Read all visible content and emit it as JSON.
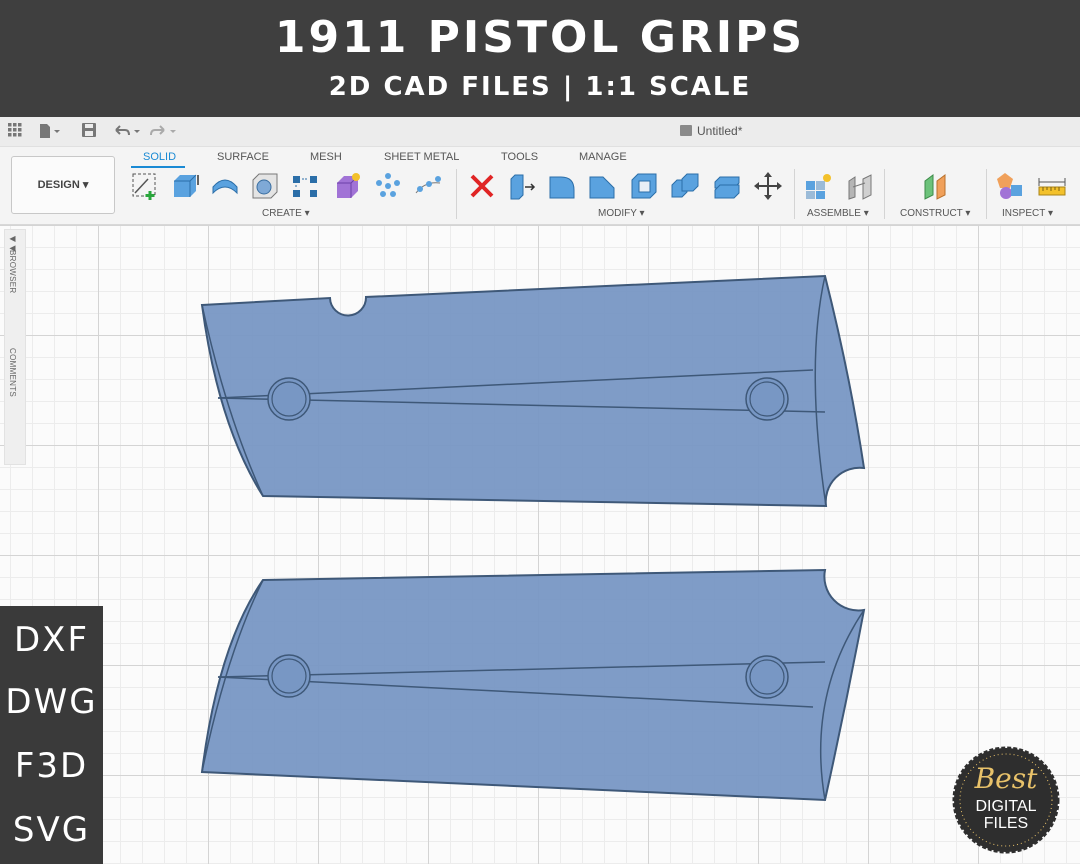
{
  "banner": {
    "title": "1911 PISTOL GRIPS",
    "subtitle": "2D CAD FILES | 1:1 SCALE"
  },
  "app": {
    "document_title": "Untitled*"
  },
  "workspace": {
    "label": "DESIGN ▾"
  },
  "tabs": [
    {
      "label": "SOLID",
      "active": true
    },
    {
      "label": "SURFACE"
    },
    {
      "label": "MESH"
    },
    {
      "label": "SHEET METAL"
    },
    {
      "label": "TOOLS"
    },
    {
      "label": "MANAGE"
    }
  ],
  "groups": {
    "create": "CREATE ▾",
    "modify": "MODIFY ▾",
    "assemble": "ASSEMBLE ▾",
    "construct": "CONSTRUCT ▾",
    "inspect": "INSPECT ▾"
  },
  "side_panel": {
    "browser": "BROWSER",
    "comments": "COMMENTS"
  },
  "formats": [
    "DXF",
    "DWG",
    "F3D",
    "SVG"
  ],
  "badge": {
    "line1": "Best",
    "line2": "DIGITAL",
    "line3": "FILES"
  },
  "colors": {
    "banner": "#3f3f3f",
    "grip_fill": "#7897c4",
    "grip_stroke": "#3e5878",
    "accent": "#1a8ad4",
    "badge_gold": "#e8c26a"
  }
}
